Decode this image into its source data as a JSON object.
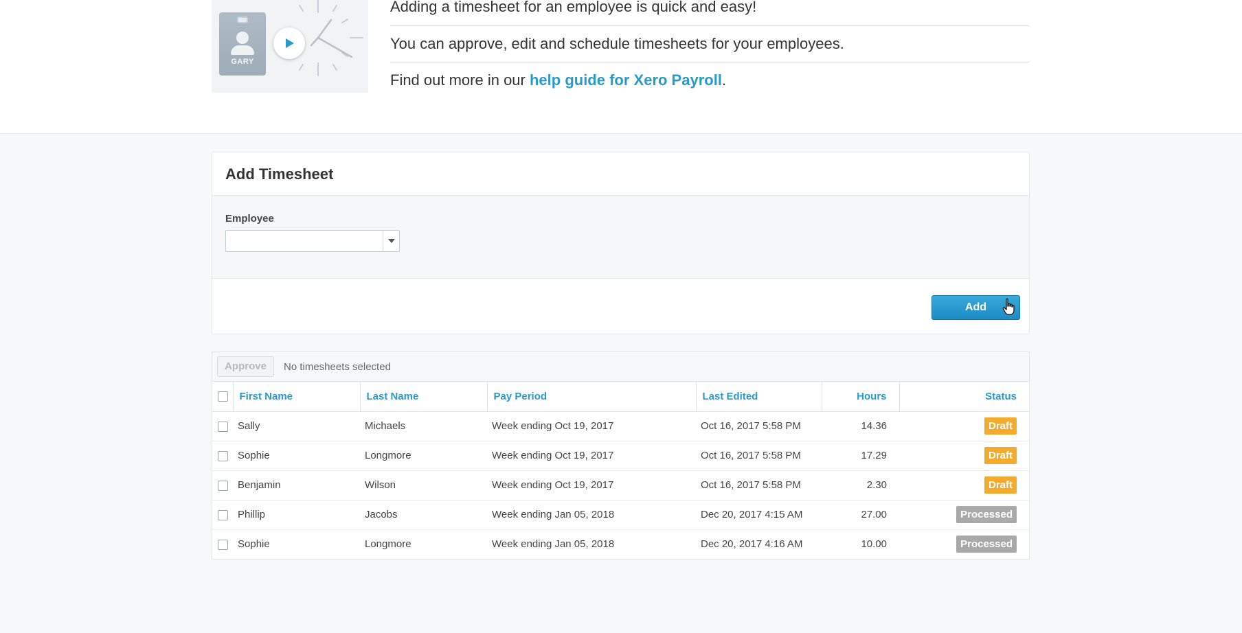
{
  "intro": {
    "line1": "Adding a timesheet for an employee is quick and easy!",
    "line2": "You can approve, edit and schedule timesheets for your employees.",
    "line3_prefix": "Find out more in our ",
    "line3_link": "help guide for Xero Payroll",
    "line3_suffix": "."
  },
  "illustration": {
    "badge_name": "GARY"
  },
  "add_timesheet": {
    "title": "Add Timesheet",
    "employee_label": "Employee",
    "employee_value": "",
    "add_label": "Add"
  },
  "toolbar": {
    "approve_label": "Approve",
    "selection_text": "No timesheets selected"
  },
  "table": {
    "columns": [
      "First Name",
      "Last Name",
      "Pay Period",
      "Last Edited",
      "Hours",
      "Status"
    ],
    "rows": [
      {
        "first": "Sally",
        "last": "Michaels",
        "period": "Week ending Oct 19, 2017",
        "edited": "Oct 16, 2017 5:58 PM",
        "hours": "14.36",
        "status": "Draft"
      },
      {
        "first": "Sophie",
        "last": "Longmore",
        "period": "Week ending Oct 19, 2017",
        "edited": "Oct 16, 2017 5:58 PM",
        "hours": "17.29",
        "status": "Draft"
      },
      {
        "first": "Benjamin",
        "last": "Wilson",
        "period": "Week ending Oct 19, 2017",
        "edited": "Oct 16, 2017 5:58 PM",
        "hours": "2.30",
        "status": "Draft"
      },
      {
        "first": "Phillip",
        "last": "Jacobs",
        "period": "Week ending Jan 05, 2018",
        "edited": "Dec 20, 2017 4:15 AM",
        "hours": "27.00",
        "status": "Processed"
      },
      {
        "first": "Sophie",
        "last": "Longmore",
        "period": "Week ending Jan 05, 2018",
        "edited": "Dec 20, 2017 4:16 AM",
        "hours": "10.00",
        "status": "Processed"
      }
    ]
  },
  "colors": {
    "accent": "#2a9ac9",
    "draft": "#f2ab2c",
    "processed": "#a9a9a9",
    "add_button": "#2196cd"
  }
}
